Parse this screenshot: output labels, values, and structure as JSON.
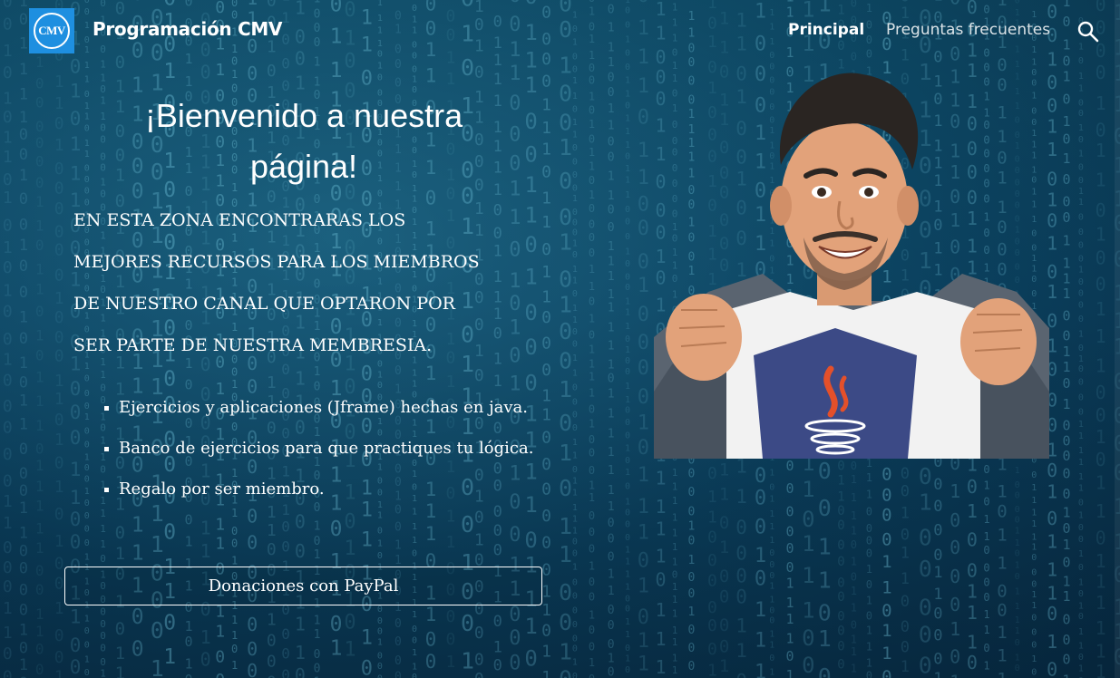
{
  "header": {
    "logo_text": "CMV",
    "site_title": "Programación CMV",
    "nav": [
      {
        "label": "Principal",
        "active": true
      },
      {
        "label": "Preguntas frecuentes",
        "active": false
      }
    ],
    "search_icon": "search-icon"
  },
  "main": {
    "welcome_line1": "¡Bienvenido a nuestra",
    "welcome_line2": "página!",
    "intro_lines": [
      "EN ESTA ZONA  ENCONTRARAS LOS",
      "MEJORES RECURSOS PARA LOS MIEMBROS",
      "DE NUESTRO CANAL QUE OPTARON POR",
      "SER PARTE DE NUESTRA MEMBRESIA."
    ],
    "features": [
      "Ejercicios y aplicaciones (Jframe) hechas en java.",
      "Banco de ejercicios para que practiques tu lógica.",
      "Regalo por ser miembro."
    ],
    "paypal_button": "Donaciones con PayPal"
  },
  "colors": {
    "background": "#0b3a52",
    "logo": "#1e8fe0",
    "text": "#ffffff"
  }
}
